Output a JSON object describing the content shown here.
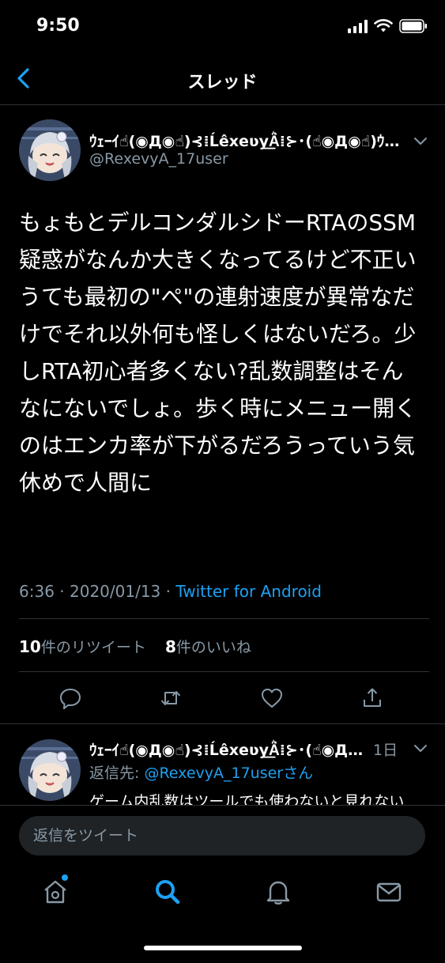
{
  "status_bar": {
    "time": "9:50"
  },
  "nav": {
    "title": "スレッド"
  },
  "tweet": {
    "author_name": "ｳｪｰｲ☝(◉Д◉☝)⊰⁞Ĺêxeʋy͟Ä͛⁞⊱･(☝◉Д◉☝)ｳｪｰｲ",
    "author_handle": "@RexevyA_17user",
    "text": "もょもとデルコンダルシドーRTAのSSM疑惑がなんか大きくなってるけど不正いうても最初の\"ぺ\"の連射速度が異常なだけでそれ以外何も怪しくはないだろ。少しRTA初心者多くない?乱数調整はそんなにないでしょ。歩く時にメニュー開くのはエンカ率が下がるだろうっていう気休めで人間に",
    "time": "6:36",
    "date": "2020/01/13",
    "source": "Twitter for Android",
    "retweet_count": "10",
    "retweet_label": "件のリツイート",
    "like_count": "8",
    "like_label": "件のいいね"
  },
  "reply": {
    "author_name": "ｳｪｰｲ☝(◉Д◉☝)⊰⁞Ĺêxeʋy͟Ä͛⁞⊱･(☝◉Д◉☝)",
    "time": "1日",
    "reply_prefix": "返信先: ",
    "reply_mention": "@RexevyA_17userさん",
    "text": "ゲーム内乱数はツールでも使わないと見れない"
  },
  "compose": {
    "placeholder": "返信をツイート"
  },
  "colors": {
    "accent": "#1da1f2",
    "secondary_text": "#8899a6",
    "divider": "#2f3336"
  }
}
